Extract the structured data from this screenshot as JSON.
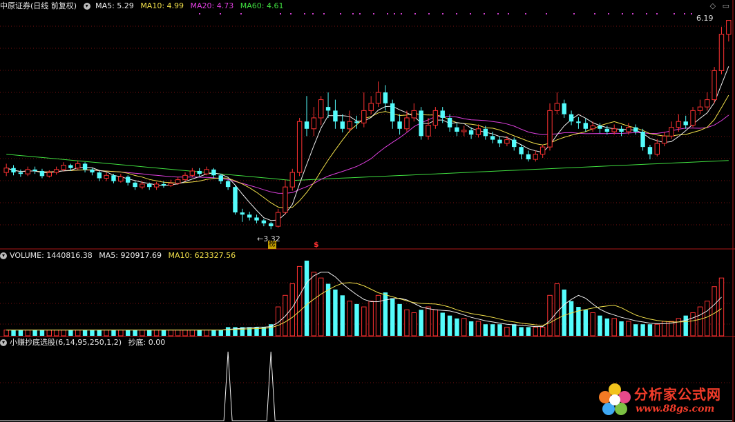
{
  "main_panel": {
    "header_title": "中原证券(日线 前复权)",
    "ma5_label": "MA5: 5.29",
    "ma10_label": "MA10: 4.99",
    "ma20_label": "MA20: 4.73",
    "ma60_label": "MA60: 4.61",
    "high_label": "6.19",
    "low_label": "3.32",
    "marker_bang": "榜",
    "marker_dollar": "$",
    "colors": {
      "ma5": "#f0f0f0",
      "ma10": "#f2e04a",
      "ma20": "#e040e0",
      "ma60": "#40e040",
      "up": "#ff3232",
      "down": "#54fcfc"
    }
  },
  "volume_panel": {
    "label": "VOLUME: 1440816.38",
    "ma5_label": "MA5: 920917.69",
    "ma10_label": "MA10: 623327.56"
  },
  "indicator_panel": {
    "title": "小赚抄底选股(6,14,95,250,1,2)",
    "value_label": "抄底: 0.00"
  },
  "watermark": {
    "title": "分析家公式网",
    "url": "www.88gs.com"
  },
  "chart_data": {
    "type": "candlestick",
    "price_range": [
      3.2,
      6.3
    ],
    "high": 6.19,
    "low": 3.32,
    "candles": [
      {
        "o": 4.1,
        "c": 4.16,
        "h": 4.22,
        "l": 4.05
      },
      {
        "o": 4.16,
        "c": 4.1,
        "h": 4.2,
        "l": 4.06
      },
      {
        "o": 4.1,
        "c": 4.08,
        "h": 4.14,
        "l": 4.04
      },
      {
        "o": 4.08,
        "c": 4.14,
        "h": 4.18,
        "l": 4.05
      },
      {
        "o": 4.14,
        "c": 4.12,
        "h": 4.18,
        "l": 4.08
      },
      {
        "o": 4.12,
        "c": 4.05,
        "h": 4.15,
        "l": 4.02
      },
      {
        "o": 4.05,
        "c": 4.1,
        "h": 4.13,
        "l": 4.03
      },
      {
        "o": 4.1,
        "c": 4.14,
        "h": 4.18,
        "l": 4.07
      },
      {
        "o": 4.14,
        "c": 4.2,
        "h": 4.24,
        "l": 4.12
      },
      {
        "o": 4.2,
        "c": 4.16,
        "h": 4.22,
        "l": 4.12
      },
      {
        "o": 4.16,
        "c": 4.22,
        "h": 4.26,
        "l": 4.14
      },
      {
        "o": 4.22,
        "c": 4.14,
        "h": 4.24,
        "l": 4.1
      },
      {
        "o": 4.14,
        "c": 4.1,
        "h": 4.16,
        "l": 4.06
      },
      {
        "o": 4.1,
        "c": 4.02,
        "h": 4.12,
        "l": 3.98
      },
      {
        "o": 4.02,
        "c": 4.06,
        "h": 4.1,
        "l": 3.98
      },
      {
        "o": 4.06,
        "c": 3.98,
        "h": 4.08,
        "l": 3.95
      },
      {
        "o": 3.98,
        "c": 4.04,
        "h": 4.08,
        "l": 3.96
      },
      {
        "o": 4.04,
        "c": 3.96,
        "h": 4.06,
        "l": 3.92
      },
      {
        "o": 3.96,
        "c": 3.9,
        "h": 3.98,
        "l": 3.86
      },
      {
        "o": 3.9,
        "c": 3.94,
        "h": 3.98,
        "l": 3.87
      },
      {
        "o": 3.94,
        "c": 3.9,
        "h": 3.96,
        "l": 3.86
      },
      {
        "o": 3.9,
        "c": 3.94,
        "h": 3.97,
        "l": 3.86
      },
      {
        "o": 3.94,
        "c": 3.92,
        "h": 3.98,
        "l": 3.89
      },
      {
        "o": 3.92,
        "c": 3.95,
        "h": 4.0,
        "l": 3.9
      },
      {
        "o": 3.95,
        "c": 4.0,
        "h": 4.04,
        "l": 3.93
      },
      {
        "o": 4.0,
        "c": 4.06,
        "h": 4.1,
        "l": 3.98
      },
      {
        "o": 4.06,
        "c": 4.12,
        "h": 4.16,
        "l": 4.04
      },
      {
        "o": 4.12,
        "c": 4.08,
        "h": 4.16,
        "l": 4.05
      },
      {
        "o": 4.08,
        "c": 4.14,
        "h": 4.18,
        "l": 4.06
      },
      {
        "o": 4.14,
        "c": 4.06,
        "h": 4.16,
        "l": 4.02
      },
      {
        "o": 4.06,
        "c": 3.98,
        "h": 4.08,
        "l": 3.94
      },
      {
        "o": 3.98,
        "c": 3.9,
        "h": 4.0,
        "l": 3.86
      },
      {
        "o": 3.9,
        "c": 3.55,
        "h": 3.92,
        "l": 3.52
      },
      {
        "o": 3.55,
        "c": 3.52,
        "h": 3.6,
        "l": 3.42
      },
      {
        "o": 3.52,
        "c": 3.48,
        "h": 3.56,
        "l": 3.44
      },
      {
        "o": 3.48,
        "c": 3.44,
        "h": 3.52,
        "l": 3.4
      },
      {
        "o": 3.44,
        "c": 3.4,
        "h": 3.46,
        "l": 3.36
      },
      {
        "o": 3.4,
        "c": 3.36,
        "h": 3.42,
        "l": 3.32
      },
      {
        "o": 3.36,
        "c": 3.55,
        "h": 3.6,
        "l": 3.34
      },
      {
        "o": 3.55,
        "c": 3.9,
        "h": 4.0,
        "l": 3.52
      },
      {
        "o": 3.9,
        "c": 4.1,
        "h": 4.15,
        "l": 3.85
      },
      {
        "o": 4.1,
        "c": 4.8,
        "h": 4.85,
        "l": 4.05
      },
      {
        "o": 4.8,
        "c": 4.7,
        "h": 5.15,
        "l": 4.6
      },
      {
        "o": 4.7,
        "c": 4.85,
        "h": 5.0,
        "l": 4.6
      },
      {
        "o": 4.85,
        "c": 5.1,
        "h": 5.15,
        "l": 4.75
      },
      {
        "o": 5.0,
        "c": 4.95,
        "h": 5.2,
        "l": 4.85
      },
      {
        "o": 4.95,
        "c": 4.8,
        "h": 5.1,
        "l": 4.7
      },
      {
        "o": 4.8,
        "c": 4.7,
        "h": 4.9,
        "l": 4.65
      },
      {
        "o": 4.7,
        "c": 4.8,
        "h": 4.95,
        "l": 4.65
      },
      {
        "o": 4.8,
        "c": 4.78,
        "h": 4.88,
        "l": 4.7
      },
      {
        "o": 4.78,
        "c": 4.95,
        "h": 5.2,
        "l": 4.72
      },
      {
        "o": 4.95,
        "c": 5.05,
        "h": 5.15,
        "l": 4.9
      },
      {
        "o": 5.05,
        "c": 5.2,
        "h": 5.35,
        "l": 5.0
      },
      {
        "o": 5.2,
        "c": 5.05,
        "h": 5.3,
        "l": 4.95
      },
      {
        "o": 5.05,
        "c": 4.8,
        "h": 5.1,
        "l": 4.7
      },
      {
        "o": 4.8,
        "c": 4.7,
        "h": 4.9,
        "l": 4.62
      },
      {
        "o": 4.7,
        "c": 4.85,
        "h": 4.95,
        "l": 4.66
      },
      {
        "o": 4.85,
        "c": 4.95,
        "h": 5.05,
        "l": 4.8
      },
      {
        "o": 4.95,
        "c": 4.6,
        "h": 5.0,
        "l": 4.55
      },
      {
        "o": 4.6,
        "c": 4.75,
        "h": 4.85,
        "l": 4.55
      },
      {
        "o": 4.75,
        "c": 4.95,
        "h": 5.0,
        "l": 4.7
      },
      {
        "o": 4.95,
        "c": 4.85,
        "h": 5.0,
        "l": 4.78
      },
      {
        "o": 4.85,
        "c": 4.72,
        "h": 4.9,
        "l": 4.66
      },
      {
        "o": 4.72,
        "c": 4.66,
        "h": 4.78,
        "l": 4.6
      },
      {
        "o": 4.66,
        "c": 4.68,
        "h": 4.74,
        "l": 4.6
      },
      {
        "o": 4.68,
        "c": 4.62,
        "h": 4.72,
        "l": 4.56
      },
      {
        "o": 4.62,
        "c": 4.7,
        "h": 4.76,
        "l": 4.58
      },
      {
        "o": 4.7,
        "c": 4.6,
        "h": 4.74,
        "l": 4.55
      },
      {
        "o": 4.6,
        "c": 4.55,
        "h": 4.66,
        "l": 4.5
      },
      {
        "o": 4.55,
        "c": 4.5,
        "h": 4.6,
        "l": 4.45
      },
      {
        "o": 4.5,
        "c": 4.55,
        "h": 4.6,
        "l": 4.46
      },
      {
        "o": 4.55,
        "c": 4.45,
        "h": 4.58,
        "l": 4.4
      },
      {
        "o": 4.45,
        "c": 4.35,
        "h": 4.48,
        "l": 4.28
      },
      {
        "o": 4.35,
        "c": 4.28,
        "h": 4.4,
        "l": 4.25
      },
      {
        "o": 4.28,
        "c": 4.35,
        "h": 4.4,
        "l": 4.25
      },
      {
        "o": 4.35,
        "c": 4.45,
        "h": 4.48,
        "l": 4.3
      },
      {
        "o": 4.45,
        "c": 4.95,
        "h": 5.05,
        "l": 4.4
      },
      {
        "o": 4.95,
        "c": 5.05,
        "h": 5.2,
        "l": 4.9
      },
      {
        "o": 5.05,
        "c": 4.9,
        "h": 5.1,
        "l": 4.85
      },
      {
        "o": 4.9,
        "c": 4.8,
        "h": 4.95,
        "l": 4.75
      },
      {
        "o": 4.8,
        "c": 4.78,
        "h": 4.86,
        "l": 4.7
      },
      {
        "o": 4.78,
        "c": 4.7,
        "h": 4.84,
        "l": 4.66
      },
      {
        "o": 4.7,
        "c": 4.74,
        "h": 4.8,
        "l": 4.66
      },
      {
        "o": 4.74,
        "c": 4.7,
        "h": 4.78,
        "l": 4.64
      },
      {
        "o": 4.7,
        "c": 4.66,
        "h": 4.74,
        "l": 4.62
      },
      {
        "o": 4.66,
        "c": 4.7,
        "h": 4.76,
        "l": 4.62
      },
      {
        "o": 4.7,
        "c": 4.66,
        "h": 4.74,
        "l": 4.6
      },
      {
        "o": 4.66,
        "c": 4.72,
        "h": 4.78,
        "l": 4.62
      },
      {
        "o": 4.72,
        "c": 4.66,
        "h": 4.76,
        "l": 4.62
      },
      {
        "o": 4.66,
        "c": 4.45,
        "h": 4.7,
        "l": 4.4
      },
      {
        "o": 4.45,
        "c": 4.35,
        "h": 4.48,
        "l": 4.28
      },
      {
        "o": 4.35,
        "c": 4.5,
        "h": 4.56,
        "l": 4.32
      },
      {
        "o": 4.5,
        "c": 4.6,
        "h": 4.66,
        "l": 4.46
      },
      {
        "o": 4.6,
        "c": 4.72,
        "h": 4.8,
        "l": 4.56
      },
      {
        "o": 4.72,
        "c": 4.8,
        "h": 4.9,
        "l": 4.66
      },
      {
        "o": 4.8,
        "c": 4.75,
        "h": 4.88,
        "l": 4.7
      },
      {
        "o": 4.75,
        "c": 4.95,
        "h": 5.0,
        "l": 4.72
      },
      {
        "o": 4.95,
        "c": 5.0,
        "h": 5.1,
        "l": 4.9
      },
      {
        "o": 5.0,
        "c": 5.1,
        "h": 5.2,
        "l": 4.95
      },
      {
        "o": 5.1,
        "c": 5.5,
        "h": 5.55,
        "l": 5.05
      },
      {
        "o": 5.5,
        "c": 6.0,
        "h": 6.1,
        "l": 5.45
      },
      {
        "o": 6.0,
        "c": 6.19,
        "h": 6.19,
        "l": 5.9
      }
    ],
    "volume": [
      2,
      2,
      2,
      2,
      2,
      2,
      2,
      2,
      2,
      2,
      2,
      2,
      2,
      2,
      2,
      2,
      2,
      2,
      2,
      2,
      2,
      2,
      2,
      2,
      2,
      2,
      2,
      2,
      2,
      2,
      2,
      3,
      3,
      3,
      3,
      3,
      3,
      4,
      10,
      14,
      18,
      24,
      26,
      22,
      20,
      18,
      16,
      14,
      12,
      11,
      10,
      12,
      14,
      15,
      13,
      11,
      9,
      8,
      9,
      10,
      9,
      8,
      7,
      6,
      6,
      5,
      5,
      4,
      4,
      4,
      3,
      4,
      3,
      3,
      3,
      3,
      14,
      18,
      16,
      12,
      10,
      9,
      8,
      7,
      6,
      6,
      5,
      5,
      4,
      4,
      4,
      4,
      5,
      5,
      6,
      7,
      8,
      10,
      12,
      17,
      20
    ],
    "indicator": {
      "name": "抄底",
      "peaks_at_candle": [
        31,
        37
      ],
      "value": 0.0
    }
  }
}
